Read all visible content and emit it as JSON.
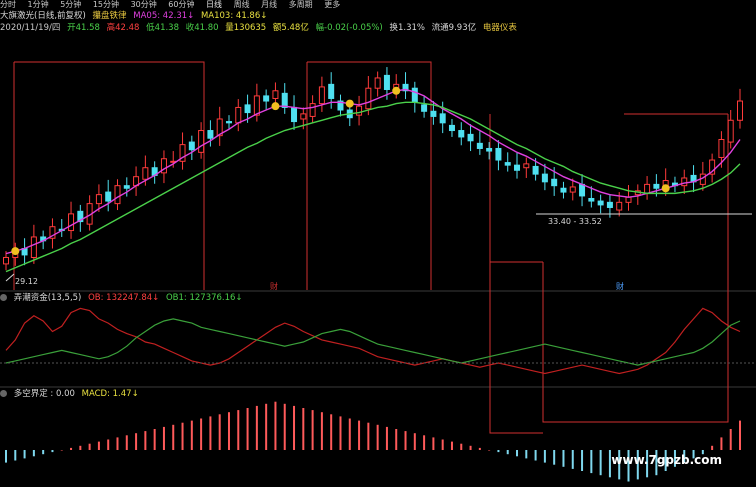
{
  "topbar": {
    "items": [
      "分时",
      "1分钟",
      "5分钟",
      "15分钟",
      "30分钟",
      "60分钟",
      "日线",
      "周线",
      "月线",
      "多周期",
      "更多"
    ]
  },
  "price_header": {
    "indicator_name": "大旗激光(日线,前复权)",
    "line2_label": "攥盘铁律",
    "ma05": "MA05: 42.31↓",
    "ma103": "MA103: 41.86↓",
    "date": "2020/11/19/四",
    "open": "开41.58",
    "high": "高42.48",
    "low": "低41.38",
    "close": "收41.80",
    "volume": "量130635",
    "amount": "额5.48亿",
    "change": "幅-0.02(-0.05%)",
    "turnover": "换1.31%",
    "float_cap": "流通9.93亿",
    "sector": "电器仪表"
  },
  "chip_header": {
    "name": "弄潮资金(13,5,5)",
    "ob": "OB: 132247.84↓",
    "ob1": "OB1: 127376.16↓"
  },
  "macd_header": {
    "name": "多空界定 : 0.00",
    "macd": "MACD: 1.47↓"
  },
  "annotations": {
    "low_price": "29.12",
    "range_label": "33.40 - 33.52",
    "marker_a": "财",
    "marker_b": "财"
  },
  "watermark": "www.7gpzb.com",
  "colors": {
    "up": "#ff3b3b",
    "down": "#4fe0f0",
    "ma_fast": "#e040e0",
    "ma_slow": "#4ad04a",
    "frame": "#d03030",
    "macd_pos": "#ff5a5a",
    "macd_neg": "#7fd8ee",
    "ob_line": "#c02020",
    "ob1_line": "#3aa03a"
  },
  "chart_data": {
    "type": "candlestick",
    "closes": [
      29.6,
      30.1,
      29.8,
      31.2,
      30.9,
      32.0,
      31.7,
      33.0,
      32.4,
      33.8,
      34.5,
      34.0,
      35.2,
      35.0,
      35.9,
      36.6,
      36.0,
      37.3,
      37.1,
      38.4,
      38.0,
      39.5,
      38.9,
      40.4,
      40.1,
      41.3,
      40.9,
      42.2,
      41.8,
      42.6,
      41.3,
      40.2,
      40.8,
      41.6,
      42.9,
      42.0,
      41.1,
      40.5,
      41.4,
      42.8,
      43.6,
      42.7,
      43.1,
      42.6,
      41.7,
      41.0,
      40.6,
      40.1,
      39.5,
      39.0,
      38.7,
      38.1,
      37.9,
      37.2,
      36.8,
      36.4,
      36.9,
      36.1,
      35.5,
      35.2,
      34.7,
      35.1,
      34.4,
      34.0,
      33.7,
      33.5,
      33.9,
      34.3,
      34.8,
      35.3,
      35.0,
      35.6,
      35.2,
      35.8,
      35.5,
      36.1,
      37.2,
      38.8,
      40.3,
      41.8
    ],
    "ma_fast": [
      29.9,
      30.1,
      30.3,
      30.6,
      30.9,
      31.3,
      31.7,
      32.1,
      32.5,
      32.9,
      33.4,
      33.8,
      34.3,
      34.7,
      35.2,
      35.6,
      36.0,
      36.5,
      36.9,
      37.4,
      37.8,
      38.3,
      38.7,
      39.2,
      39.6,
      40.1,
      40.4,
      40.8,
      41.1,
      41.4,
      41.4,
      41.3,
      41.2,
      41.3,
      41.5,
      41.7,
      41.7,
      41.6,
      41.5,
      41.7,
      42.0,
      42.3,
      42.6,
      42.7,
      42.5,
      42.2,
      41.7,
      41.2,
      40.8,
      40.4,
      39.9,
      39.5,
      39.1,
      38.6,
      38.2,
      37.8,
      37.5,
      37.1,
      36.7,
      36.3,
      35.9,
      35.6,
      35.3,
      35.0,
      34.7,
      34.5,
      34.4,
      34.3,
      34.4,
      34.6,
      34.8,
      35.0,
      35.2,
      35.4,
      35.5,
      35.8,
      36.3,
      37.0,
      37.8,
      38.8
    ],
    "ma_slow": [
      28.5,
      28.8,
      29.1,
      29.4,
      29.7,
      30.0,
      30.3,
      30.7,
      31.0,
      31.4,
      31.8,
      32.2,
      32.6,
      33.0,
      33.4,
      33.8,
      34.2,
      34.6,
      35.0,
      35.4,
      35.8,
      36.2,
      36.6,
      37.0,
      37.4,
      37.8,
      38.2,
      38.5,
      38.9,
      39.2,
      39.5,
      39.7,
      39.9,
      40.1,
      40.3,
      40.5,
      40.7,
      40.8,
      40.9,
      41.1,
      41.3,
      41.4,
      41.6,
      41.7,
      41.7,
      41.6,
      41.5,
      41.3,
      41.0,
      40.7,
      40.4,
      40.0,
      39.6,
      39.2,
      38.8,
      38.4,
      38.1,
      37.7,
      37.3,
      37.0,
      36.7,
      36.3,
      36.0,
      35.7,
      35.4,
      35.2,
      35.0,
      34.8,
      34.7,
      34.6,
      34.6,
      34.6,
      34.6,
      34.7,
      34.8,
      35.0,
      35.3,
      35.7,
      36.2,
      36.9
    ],
    "ob": [
      32,
      42,
      58,
      65,
      60,
      50,
      55,
      68,
      72,
      70,
      62,
      58,
      52,
      48,
      45,
      40,
      38,
      34,
      30,
      26,
      22,
      20,
      18,
      20,
      24,
      30,
      36,
      42,
      48,
      54,
      58,
      55,
      50,
      46,
      42,
      40,
      38,
      36,
      34,
      30,
      26,
      24,
      22,
      20,
      18,
      20,
      22,
      24,
      22,
      20,
      18,
      16,
      18,
      20,
      18,
      16,
      14,
      12,
      10,
      12,
      14,
      16,
      18,
      16,
      14,
      12,
      10,
      12,
      14,
      18,
      24,
      30,
      40,
      52,
      62,
      72,
      68,
      60,
      54,
      50
    ],
    "ob1": [
      20,
      22,
      24,
      26,
      28,
      30,
      32,
      30,
      28,
      26,
      24,
      26,
      30,
      36,
      44,
      50,
      56,
      60,
      62,
      60,
      58,
      54,
      52,
      50,
      48,
      46,
      44,
      42,
      40,
      38,
      36,
      38,
      40,
      44,
      48,
      50,
      52,
      50,
      46,
      42,
      38,
      36,
      34,
      32,
      30,
      28,
      26,
      24,
      22,
      20,
      22,
      24,
      26,
      28,
      30,
      32,
      34,
      36,
      38,
      36,
      34,
      32,
      30,
      28,
      26,
      24,
      22,
      20,
      18,
      20,
      22,
      24,
      26,
      28,
      30,
      34,
      40,
      48,
      56,
      60
    ],
    "macd": [
      -6,
      -5,
      -4,
      -3,
      -2,
      -1,
      0,
      1,
      2,
      3,
      4,
      5,
      6,
      7,
      8,
      9,
      10,
      11,
      12,
      13,
      14,
      15,
      16,
      17,
      18,
      19,
      20,
      21,
      22,
      23,
      22,
      21,
      20,
      19,
      18,
      17,
      16,
      15,
      14,
      13,
      12,
      11,
      10,
      9,
      8,
      7,
      6,
      5,
      4,
      3,
      2,
      1,
      0,
      -1,
      -2,
      -3,
      -4,
      -5,
      -6,
      -7,
      -8,
      -9,
      -10,
      -11,
      -12,
      -13,
      -14,
      -15,
      -14,
      -13,
      -12,
      -10,
      -8,
      -6,
      -4,
      -2,
      2,
      6,
      10,
      14
    ]
  }
}
